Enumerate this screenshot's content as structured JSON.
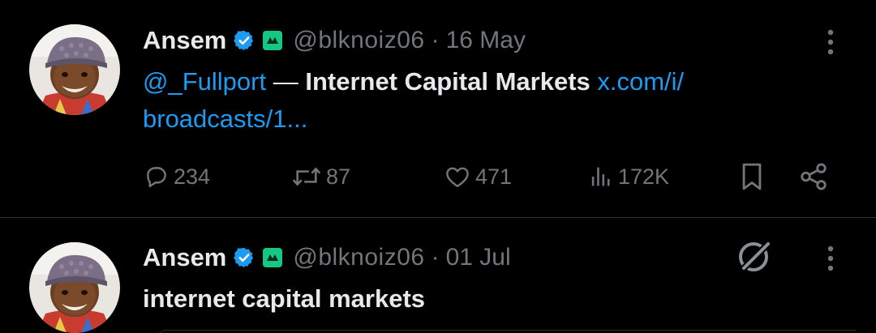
{
  "colors": {
    "background": "#000000",
    "text_primary": "#e7e9ea",
    "text_secondary": "#71767b",
    "link": "#1d9bf0",
    "verified": "#1d9bf0",
    "affiliate_badge": "#16c784",
    "divider": "#2f3336"
  },
  "tweets": [
    {
      "author_name": "Ansem",
      "verified_icon": "verified-badge-icon",
      "affiliate_icon": "affiliate-badge-icon",
      "handle": "@blknoiz06",
      "separator": "·",
      "time": "16 May",
      "body": {
        "mention": "@_Fullport",
        "dash": " — ",
        "title": "Internet Capital Markets",
        "link_part1": " x.com/i/",
        "link_part2": "broadcasts/1..."
      },
      "actions": {
        "replies": "234",
        "reposts": "87",
        "likes": "471",
        "views": "172K"
      }
    },
    {
      "author_name": "Ansem",
      "verified_icon": "verified-badge-icon",
      "affiliate_icon": "affiliate-badge-icon",
      "handle": "@blknoiz06",
      "separator": "·",
      "time": "01 Jul",
      "body": {
        "text": "internet capital markets"
      },
      "grok_icon": "grok-icon"
    }
  ]
}
